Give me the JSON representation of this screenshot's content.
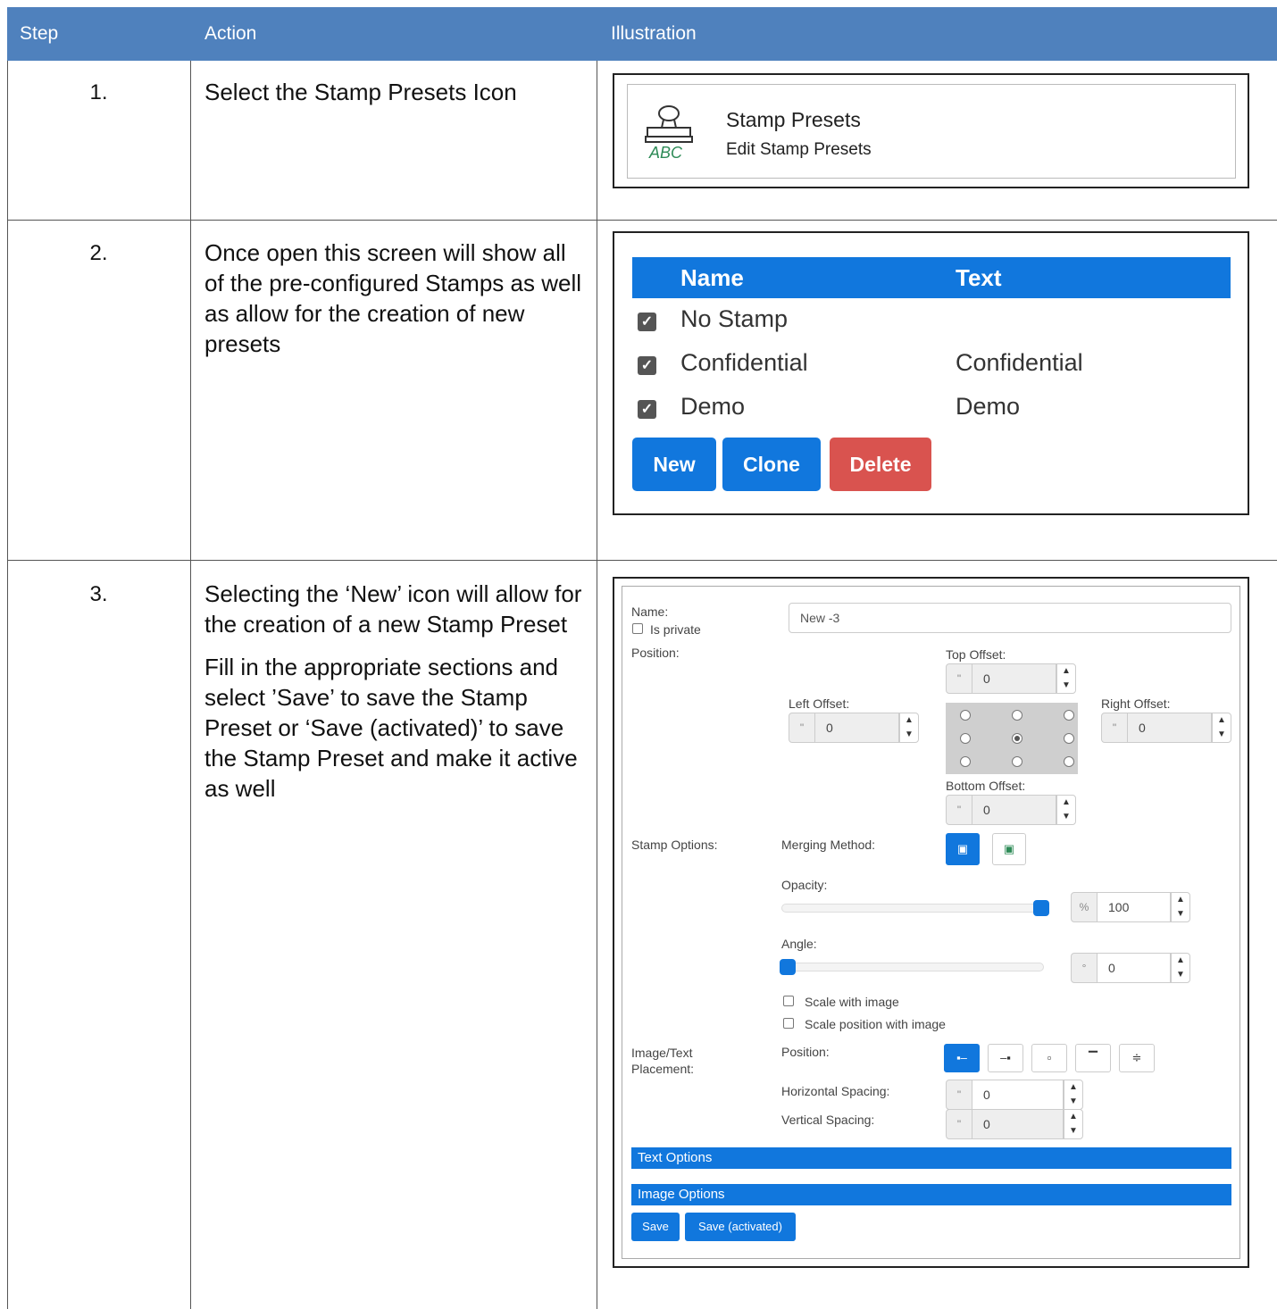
{
  "table": {
    "headers": {
      "step": "Step",
      "action": "Action",
      "illustration": "Illustration"
    },
    "rows": [
      {
        "step": "1.",
        "action": [
          "Select the Stamp Presets Icon"
        ]
      },
      {
        "step": "2.",
        "action": [
          "Once open this screen will show all of the pre-configured Stamps as well as allow for the creation of new presets"
        ]
      },
      {
        "step": "3.",
        "action": [
          "Selecting the ‘New’ icon will allow for the creation of a new Stamp Preset",
          "Fill in the appropriate sections and select ’Save’ to save the Stamp Preset or ‘Save (activated)’ to save the Stamp Preset and make it active as well"
        ]
      }
    ]
  },
  "illustration1": {
    "icon": "stamp-abc-icon",
    "title": "Stamp Presets",
    "subtitle": "Edit Stamp Presets"
  },
  "illustration2": {
    "columns": {
      "name": "Name",
      "text": "Text"
    },
    "rows": [
      {
        "checked": true,
        "name": "No Stamp",
        "text": ""
      },
      {
        "checked": true,
        "name": "Confidential",
        "text": "Confidential"
      },
      {
        "checked": true,
        "name": "Demo",
        "text": "Demo"
      }
    ],
    "buttons": {
      "new": "New",
      "clone": "Clone",
      "delete": "Delete"
    },
    "colors": {
      "header": "#1177dd",
      "primary": "#1177dd",
      "danger": "#d9534f"
    }
  },
  "illustration3": {
    "name_label": "Name:",
    "name_value": "New -3",
    "is_private_label": "Is private",
    "position_label": "Position:",
    "top_offset_label": "Top Offset:",
    "left_offset_label": "Left Offset:",
    "right_offset_label": "Right Offset:",
    "bottom_offset_label": "Bottom Offset:",
    "offset_unit": "\"",
    "top_offset": "0",
    "left_offset": "0",
    "right_offset": "0",
    "bottom_offset": "0",
    "stamp_options_label": "Stamp Options:",
    "merging_method_label": "Merging Method:",
    "opacity_label": "Opacity:",
    "opacity_unit": "%",
    "opacity_value": "100",
    "opacity_level": 1.0,
    "angle_label": "Angle:",
    "angle_unit": "°",
    "angle_value": "0",
    "angle_level": 0.0,
    "scale_with_image_label": "Scale with image",
    "scale_position_label": "Scale position with image",
    "placement_label": "Image/Text Placement:",
    "placement_position_label": "Position:",
    "horizontal_spacing_label": "Horizontal Spacing:",
    "vertical_spacing_label": "Vertical Spacing:",
    "spacing_unit": "\"",
    "horizontal_spacing": "0",
    "vertical_spacing": "0",
    "text_options_label": "Text Options",
    "image_options_label": "Image Options",
    "save_label": "Save",
    "save_activated_label": "Save (activated)"
  }
}
